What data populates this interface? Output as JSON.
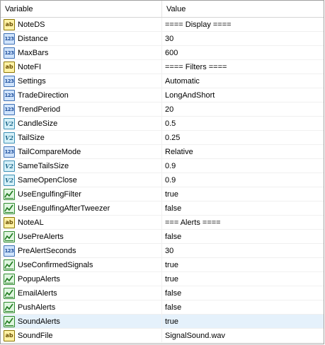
{
  "header": {
    "variable": "Variable",
    "value": "Value"
  },
  "rows": [
    {
      "type": "string",
      "name": "NoteDS",
      "value": "==== Display ===="
    },
    {
      "type": "int",
      "name": "Distance",
      "value": "30"
    },
    {
      "type": "int",
      "name": "MaxBars",
      "value": "600"
    },
    {
      "type": "string",
      "name": "NoteFI",
      "value": "==== Filters ===="
    },
    {
      "type": "int",
      "name": "Settings",
      "value": "Automatic"
    },
    {
      "type": "int",
      "name": "TradeDirection",
      "value": "LongAndShort"
    },
    {
      "type": "int",
      "name": "TrendPeriod",
      "value": "20"
    },
    {
      "type": "double",
      "name": "CandleSize",
      "value": "0.5"
    },
    {
      "type": "double",
      "name": "TailSize",
      "value": "0.25"
    },
    {
      "type": "int",
      "name": "TailCompareMode",
      "value": "Relative"
    },
    {
      "type": "double",
      "name": "SameTailsSize",
      "value": "0.9"
    },
    {
      "type": "double",
      "name": "SameOpenClose",
      "value": "0.9"
    },
    {
      "type": "bool",
      "name": "UseEngulfingFilter",
      "value": "true"
    },
    {
      "type": "bool",
      "name": "UseEngulfingAfterTweezer",
      "value": "false"
    },
    {
      "type": "string",
      "name": "NoteAL",
      "value": "=== Alerts ===="
    },
    {
      "type": "bool",
      "name": "UsePreAlerts",
      "value": "false"
    },
    {
      "type": "int",
      "name": "PreAlertSeconds",
      "value": "30"
    },
    {
      "type": "bool",
      "name": "UseConfirmedSignals",
      "value": "true"
    },
    {
      "type": "bool",
      "name": "PopupAlerts",
      "value": "true"
    },
    {
      "type": "bool",
      "name": "EmailAlerts",
      "value": "false"
    },
    {
      "type": "bool",
      "name": "PushAlerts",
      "value": "false"
    },
    {
      "type": "bool",
      "name": "SoundAlerts",
      "value": "true",
      "selected": true
    },
    {
      "type": "string",
      "name": "SoundFile",
      "value": "SignalSound.wav"
    }
  ],
  "icons": {
    "string": {
      "name": "string-type-icon",
      "glyph": "ab"
    },
    "int": {
      "name": "integer-type-icon",
      "glyph": "123"
    },
    "double": {
      "name": "double-type-icon",
      "glyph": "V2"
    },
    "bool": {
      "name": "boolean-type-icon",
      "glyph": ""
    }
  },
  "colors": {
    "selected_row": "#e5f1fb",
    "grid_border": "#a0a0a0"
  }
}
